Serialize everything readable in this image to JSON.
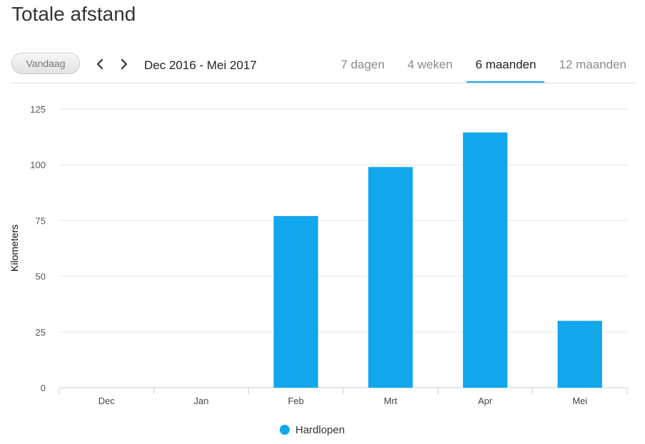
{
  "header": {
    "title": "Totale afstand"
  },
  "toolbar": {
    "today_label": "Vandaag",
    "range_label": "Dec 2016 - Mei 2017",
    "tabs": [
      {
        "label": "7 dagen",
        "active": false
      },
      {
        "label": "4 weken",
        "active": false
      },
      {
        "label": "6 maanden",
        "active": true
      },
      {
        "label": "12 maanden",
        "active": false
      }
    ]
  },
  "colors": {
    "bar": "#12a6ec",
    "accent": "#1aa7e8",
    "grid": "#e6e6e6",
    "axis": "#c4cde8"
  },
  "chart_data": {
    "type": "bar",
    "categories": [
      "Dec",
      "Jan",
      "Feb",
      "Mrt",
      "Apr",
      "Mei"
    ],
    "series": [
      {
        "name": "Hardlopen",
        "values": [
          0,
          0,
          77,
          99,
          114.5,
          30
        ]
      }
    ],
    "ylabel": "Kilometers",
    "ylim": [
      0,
      125
    ],
    "yticks": [
      0,
      25,
      50,
      75,
      100,
      125
    ],
    "grid": true,
    "legend": "bottom-center"
  }
}
